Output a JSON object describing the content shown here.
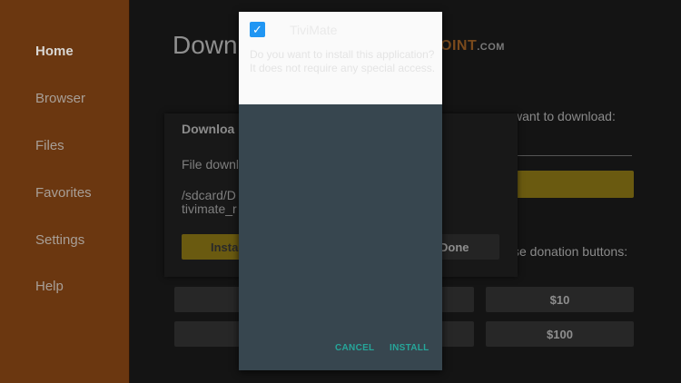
{
  "sidebar": {
    "items": [
      {
        "label": "Home",
        "active": true
      },
      {
        "label": "Browser"
      },
      {
        "label": "Files"
      },
      {
        "label": "Favorites"
      },
      {
        "label": "Settings"
      },
      {
        "label": "Help"
      }
    ]
  },
  "main": {
    "title": "Downl",
    "brand": "OINT",
    "brand_suffix": ".COM",
    "url_prompt": "want to download:",
    "donation_text": "se donation buttons:",
    "donations": [
      "$10",
      "$100"
    ]
  },
  "download_dialog": {
    "title": "Downloa",
    "message": "File downl",
    "path_line1": "/sdcard/D",
    "path_line2": "tivimate_r",
    "install_label": "Insta",
    "done_label": "Done"
  },
  "install_dialog": {
    "app_name": "TiviMate",
    "question": "Do you want to install this application? It does not require any special access.",
    "cancel_label": "CANCEL",
    "install_label": "INSTALL",
    "accent_color": "#26a69a"
  }
}
